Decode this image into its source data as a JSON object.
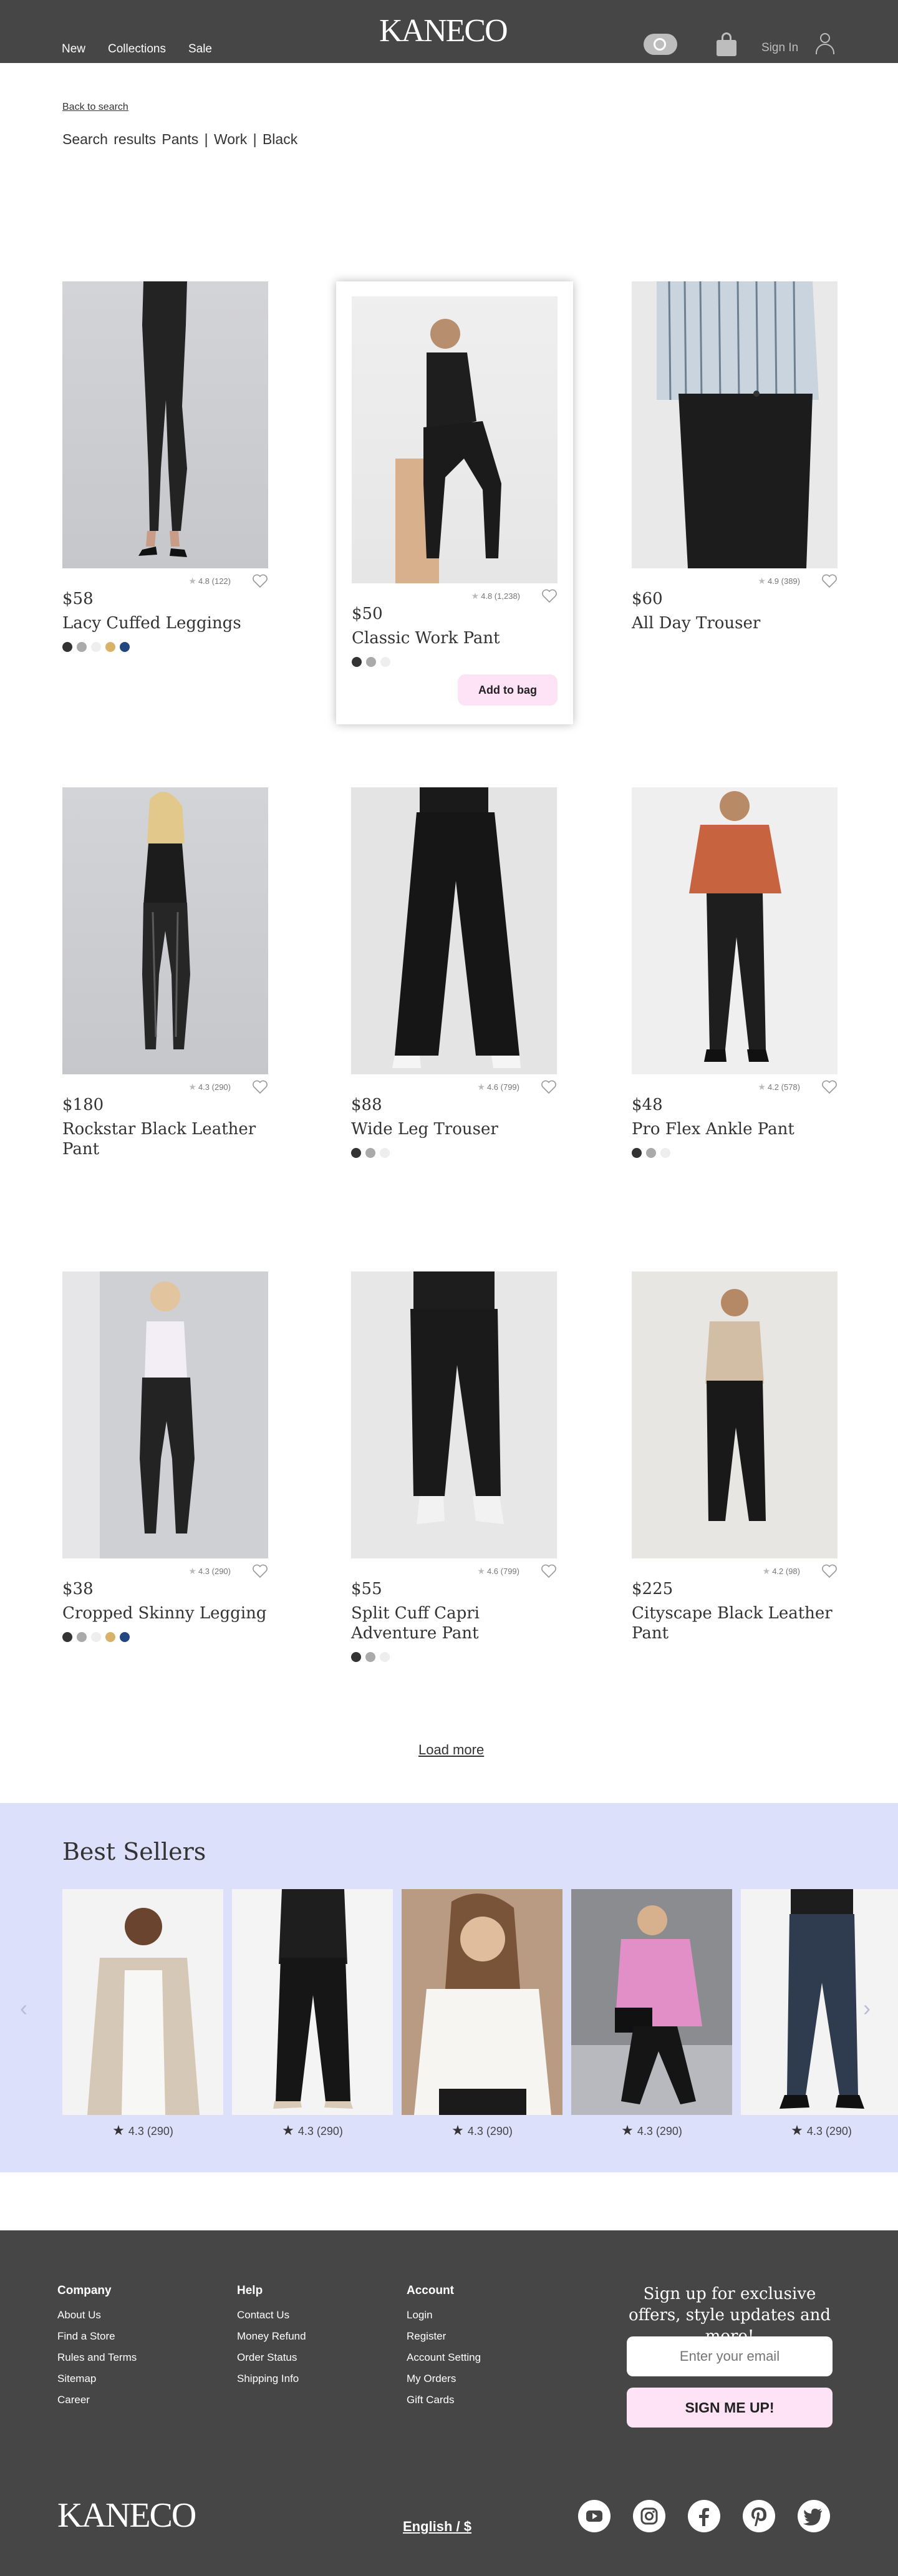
{
  "header": {
    "nav": [
      "New",
      "Collections",
      "Sale"
    ],
    "logo": "KANECO",
    "signin": "Sign In"
  },
  "search": {
    "back_label": "Back to search",
    "breadcrumb": "Search  results  Pants  |  Work  |  Black"
  },
  "products": [
    {
      "price": "$58",
      "name": "Lacy Cuffed Leggings",
      "rating": "4.8 (122)",
      "swatches": [
        "#333333",
        "#aaaaaa",
        "#eeeeee",
        "#d9b26a",
        "#24467e"
      ]
    },
    {
      "price": "$50",
      "name": "Classic Work Pant",
      "rating": "4.8 (1,238)",
      "swatches": [
        "#333333",
        "#aaaaaa",
        "#eeeeee"
      ],
      "cta": "Add to bag"
    },
    {
      "price": "$60",
      "name": "All Day Trouser",
      "rating": "4.9 (389)",
      "swatches": []
    },
    {
      "price": "$180",
      "name": "Rockstar Black Leather Pant",
      "rating": "4.3 (290)",
      "swatches": []
    },
    {
      "price": "$88",
      "name": "Wide Leg Trouser",
      "rating": "4.6 (799)",
      "swatches": [
        "#333333",
        "#aaaaaa",
        "#eeeeee"
      ]
    },
    {
      "price": "$48",
      "name": "Pro Flex Ankle Pant",
      "rating": "4.2 (578)",
      "swatches": [
        "#333333",
        "#aaaaaa",
        "#eeeeee"
      ]
    },
    {
      "price": "$38",
      "name": "Cropped Skinny Legging",
      "rating": "4.3 (290)",
      "swatches": [
        "#333333",
        "#aaaaaa",
        "#eeeeee",
        "#d9b26a",
        "#24467e"
      ]
    },
    {
      "price": "$55",
      "name": "Split Cuff Capri Adventure Pant",
      "rating": "4.6 (799)",
      "swatches": [
        "#333333",
        "#aaaaaa",
        "#eeeeee"
      ]
    },
    {
      "price": "$225",
      "name": "Cityscape Black Leather Pant",
      "rating": "4.2 (98)",
      "swatches": []
    }
  ],
  "load_more": "Load more",
  "bestsellers": {
    "title": "Best Sellers",
    "ratings": [
      "4.3 (290)",
      "4.3 (290)",
      "4.3 (290)",
      "4.3 (290)",
      "4.3 (290)"
    ]
  },
  "footer": {
    "company": {
      "title": "Company",
      "links": [
        "About Us",
        "Find a Store",
        "Rules and Terms",
        "Sitemap",
        "Career"
      ]
    },
    "help": {
      "title": "Help",
      "links": [
        "Contact Us",
        "Money Refund",
        "Order Status",
        "Shipping Info"
      ]
    },
    "account": {
      "title": "Account",
      "links": [
        "Login",
        "Register",
        "Account Setting",
        "My Orders",
        "Gift Cards"
      ]
    },
    "signup_text": "Sign up for exclusive offers, style updates and more!",
    "email_placeholder": "Enter your email",
    "signup_button": "SIGN ME UP!",
    "logo": "KANECO",
    "language": "English / $",
    "social": [
      "youtube-icon",
      "instagram-icon",
      "facebook-icon",
      "pinterest-icon",
      "twitter-icon"
    ]
  },
  "colors": {
    "header_bg": "#464646",
    "bestsellers_bg": "#dde0fb",
    "cta_pink": "#fde3f5"
  }
}
